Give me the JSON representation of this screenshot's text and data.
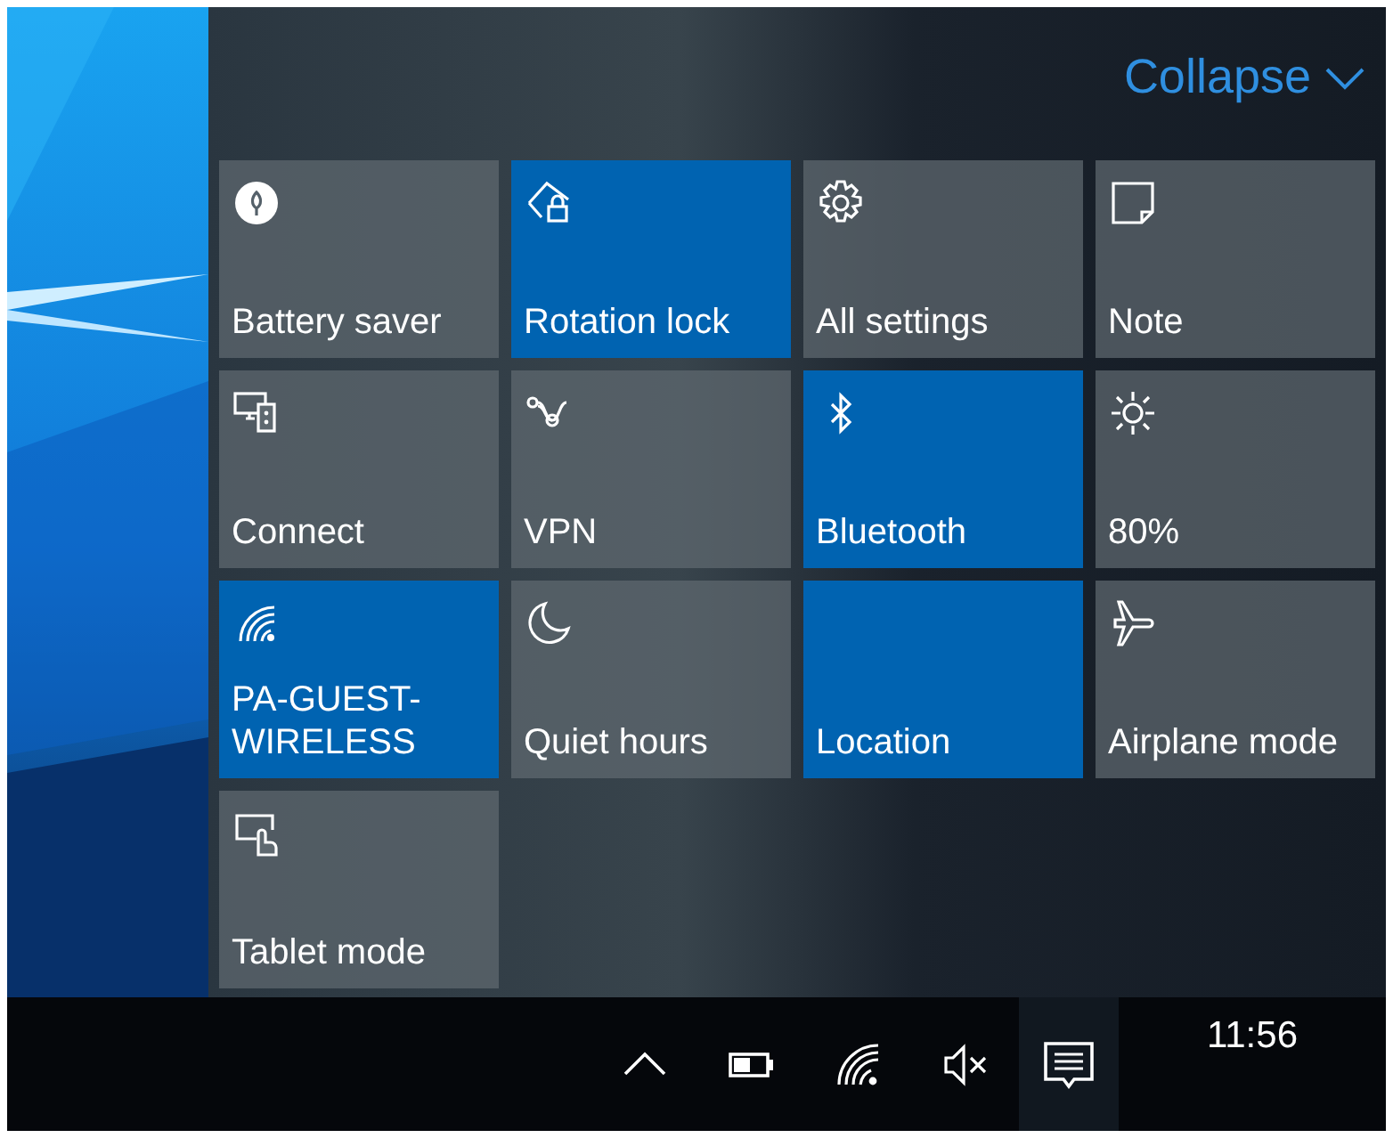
{
  "collapse_button": {
    "label": "Collapse"
  },
  "tiles": [
    {
      "label": "Battery saver",
      "on": false
    },
    {
      "label": "Rotation lock",
      "on": true
    },
    {
      "label": "All settings",
      "on": false
    },
    {
      "label": "Note",
      "on": false
    },
    {
      "label": "Connect",
      "on": false
    },
    {
      "label": "VPN",
      "on": false
    },
    {
      "label": "Bluetooth",
      "on": true
    },
    {
      "label": "80%",
      "on": false
    },
    {
      "label": "PA-GUEST-\nWIRELESS",
      "on": true
    },
    {
      "label": "Quiet hours",
      "on": false
    },
    {
      "label": "Location",
      "on": true
    },
    {
      "label": "Airplane mode",
      "on": false
    },
    {
      "label": "Tablet mode",
      "on": false
    }
  ],
  "taskbar": {
    "clock": "11:56"
  }
}
